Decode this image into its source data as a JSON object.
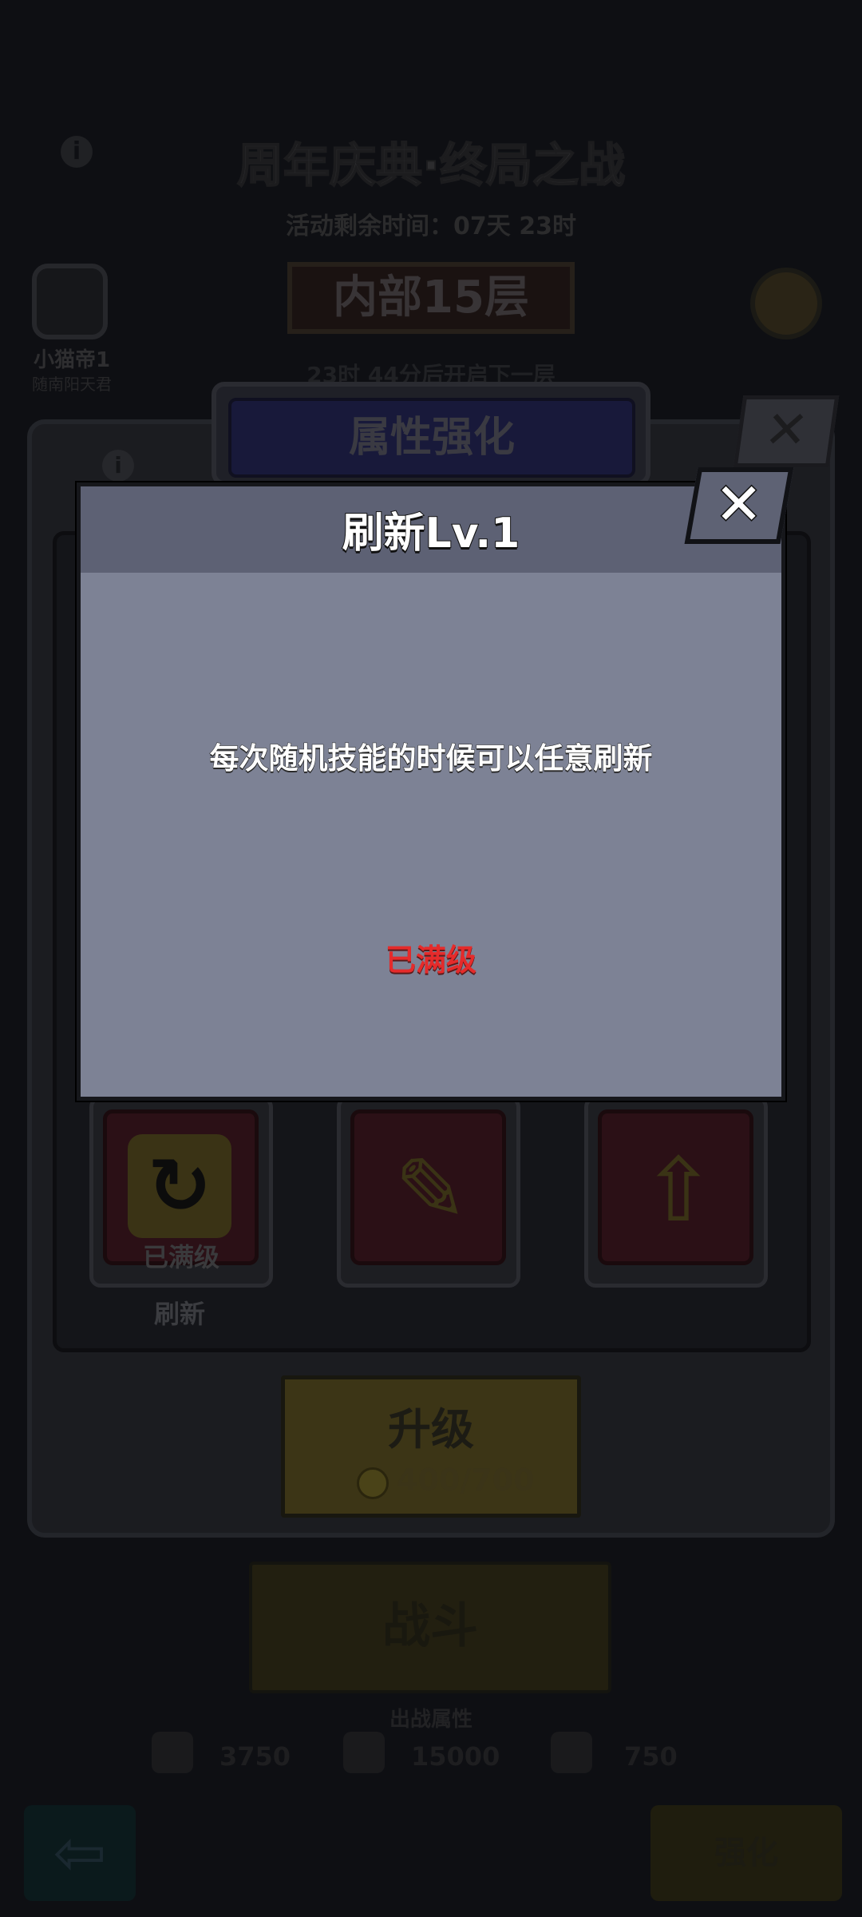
{
  "background": {
    "event_title": "周年庆典·终局之战",
    "event_remaining": "活动剩余时间：07天 23时",
    "floor_banner": "内部15层",
    "player_name": "小猫帝1",
    "player_subtitle": "随南阳天君",
    "next_floor_countdown": "23时 44分后开启下一层",
    "panel_title": "属性强化",
    "skills": [
      {
        "label": "刷新",
        "status": "已满级",
        "icon": "refresh-icon"
      },
      {
        "label": "",
        "status": "",
        "icon": "pencil-icon"
      },
      {
        "label": "",
        "status": "",
        "icon": "arrow-up-icon"
      }
    ],
    "upgrade_button": {
      "label": "升级",
      "cost": "400/700"
    },
    "battle_button": "战斗",
    "battle_subtitle": "出战属性",
    "stats": [
      "3750",
      "15000",
      "750"
    ],
    "strength_button": "强化"
  },
  "modal": {
    "title": "刷新Lv.1",
    "description": "每次随机技能的时候可以任意刷新",
    "status": "已满级",
    "close_icon": "close-icon"
  },
  "colors": {
    "modal_body": "#7d8295",
    "modal_header": "#5d6174",
    "status_red": "#e52b2b"
  }
}
